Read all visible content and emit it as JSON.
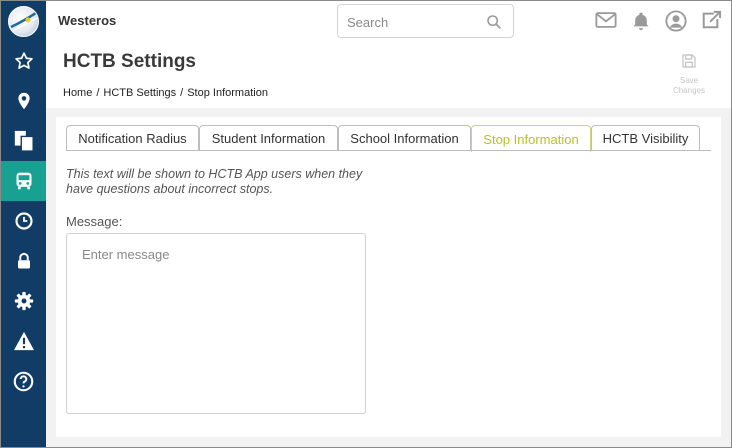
{
  "app": {
    "name": "Westeros"
  },
  "search": {
    "placeholder": "Search"
  },
  "header": {
    "title": "HCTB Settings",
    "breadcrumb": [
      "Home",
      "/",
      "HCTB Settings",
      "/",
      "Stop Information"
    ],
    "save_label_line1": "Save",
    "save_label_line2": "Changes"
  },
  "sidebar": {
    "items": [
      {
        "icon": "star-icon"
      },
      {
        "icon": "map-pin-icon"
      },
      {
        "icon": "documents-icon"
      },
      {
        "icon": "bus-icon",
        "active": true
      },
      {
        "icon": "clock-icon"
      },
      {
        "icon": "lock-icon"
      },
      {
        "icon": "gear-icon"
      },
      {
        "icon": "warning-icon"
      },
      {
        "icon": "help-icon"
      }
    ]
  },
  "topbar_icons": [
    "mail-icon",
    "bell-icon",
    "user-icon",
    "external-link-icon"
  ],
  "tabs": [
    {
      "label": "Notification Radius"
    },
    {
      "label": "Student Information"
    },
    {
      "label": "School Information"
    },
    {
      "label": "Stop Information",
      "active": true
    },
    {
      "label": "HCTB Visibility"
    }
  ],
  "stop_info": {
    "description": "This text will be shown to HCTB App users when they have questions about incorrect stops.",
    "message_label": "Message:",
    "message_placeholder": "Enter message",
    "message_value": ""
  },
  "colors": {
    "sidebar": "#103c66",
    "sidebar_active": "#18a090",
    "active_tab": "#b9c126",
    "content_bg": "#f2f2f2"
  }
}
